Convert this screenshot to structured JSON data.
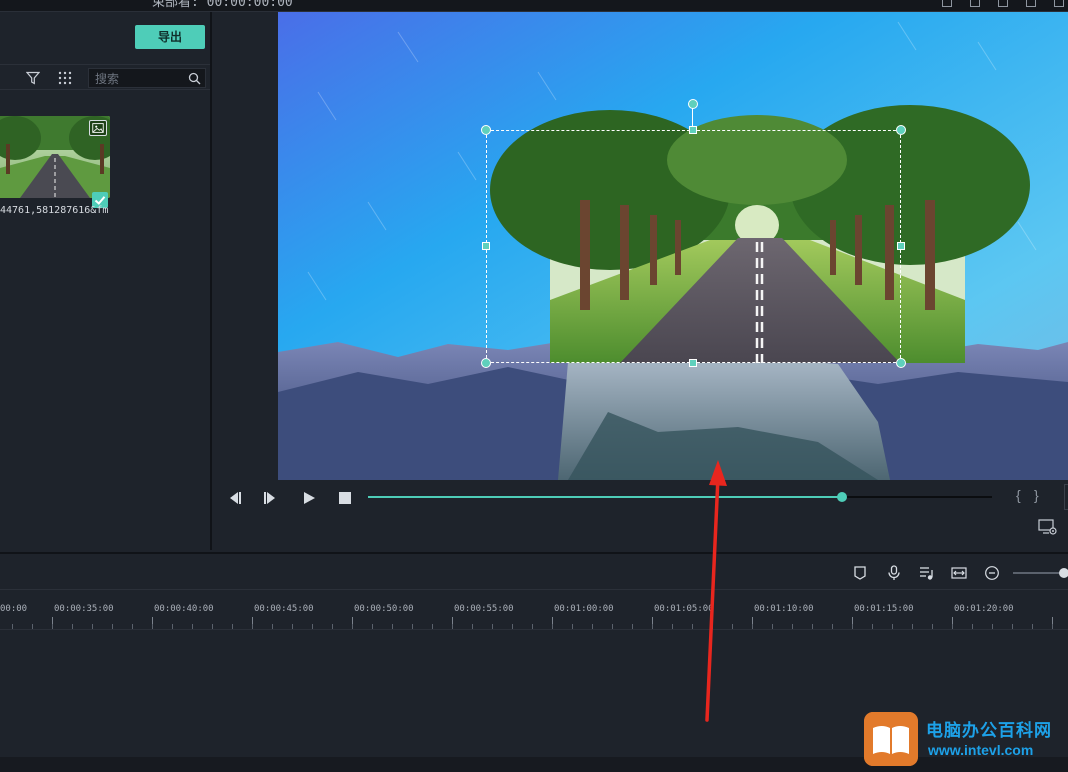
{
  "topbar": {
    "title_fragment": "束部看: 00:00:00:00"
  },
  "media_panel": {
    "export_label": "导出",
    "search_placeholder": "搜索",
    "items": [
      {
        "name": "44761,581287616&fm",
        "selected": true
      }
    ]
  },
  "preview": {
    "progress": 0.76,
    "mark_in": "{",
    "mark_out": "}"
  },
  "timeline": {
    "ruler_labels": [
      "00:00",
      "00:00:35:00",
      "00:00:40:00",
      "00:00:45:00",
      "00:00:50:00",
      "00:00:55:00",
      "00:01:00:00",
      "00:01:05:00",
      "00:01:10:00",
      "00:01:15:00",
      "00:01:20:00"
    ]
  },
  "watermark": {
    "name": "电脑办公百科网",
    "url": "www.intevl.com"
  },
  "colors": {
    "accent": "#4ecdb8",
    "panel": "#1e232b",
    "arrow": "#e8261e"
  }
}
